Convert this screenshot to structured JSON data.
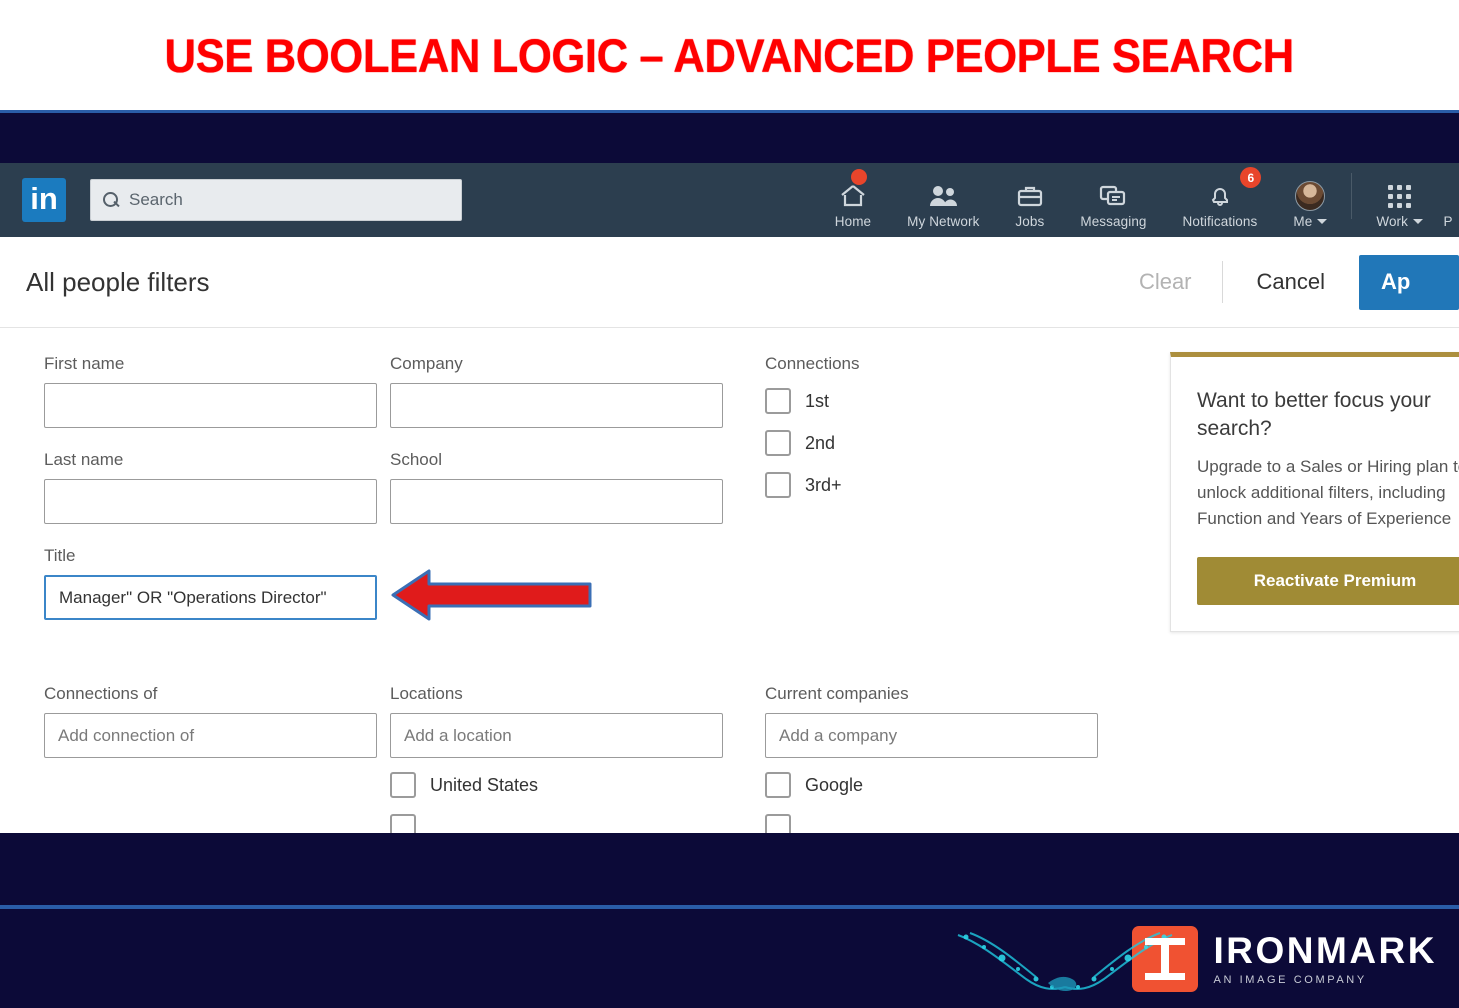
{
  "slide": {
    "title": "USE BOOLEAN LOGIC – ADVANCED PEOPLE SEARCH",
    "title_color": "#FF0000",
    "band_color": "#0C0A38",
    "accent_line_color": "#2A5DA8"
  },
  "nav": {
    "logo_text": "in",
    "logo_color": "#1B7BBF",
    "bar_color": "#2C3E4F",
    "search": {
      "placeholder": "Search",
      "icon": "search-icon",
      "value": ""
    },
    "items": [
      {
        "label": "Home",
        "icon": "home-icon",
        "badge": "",
        "badge_dot": true
      },
      {
        "label": "My Network",
        "icon": "people-icon",
        "badge": "",
        "badge_dot": false
      },
      {
        "label": "Jobs",
        "icon": "briefcase-icon",
        "badge": "",
        "badge_dot": false
      },
      {
        "label": "Messaging",
        "icon": "message-icon",
        "badge": "",
        "badge_dot": false
      },
      {
        "label": "Notifications",
        "icon": "bell-icon",
        "badge": "6",
        "badge_dot": false
      }
    ],
    "me": {
      "label": "Me",
      "icon": "avatar",
      "caret": "chevron-down-icon"
    },
    "work": {
      "label": "Work",
      "icon": "grid-icon",
      "caret": "chevron-down-icon"
    },
    "post": {
      "label": "P"
    }
  },
  "filters": {
    "title": "All people filters",
    "clear_label": "Clear",
    "cancel_label": "Cancel",
    "apply_label": "Ap",
    "apply_color": "#2177B8",
    "fields": {
      "first_name": {
        "label": "First name",
        "value": "",
        "placeholder": ""
      },
      "last_name": {
        "label": "Last name",
        "value": "",
        "placeholder": ""
      },
      "title": {
        "label": "Title",
        "value": "Manager\" OR \"Operations Director\"",
        "focused": true
      },
      "company": {
        "label": "Company",
        "value": "",
        "placeholder": ""
      },
      "school": {
        "label": "School",
        "value": "",
        "placeholder": ""
      },
      "connections_of": {
        "label": "Connections of",
        "value": "",
        "placeholder": "Add connection of"
      },
      "locations": {
        "label": "Locations",
        "value": "",
        "placeholder": "Add a location"
      },
      "current_companies": {
        "label": "Current companies",
        "value": "",
        "placeholder": "Add a company"
      }
    },
    "connections": {
      "label": "Connections",
      "options": [
        {
          "label": "1st",
          "checked": false
        },
        {
          "label": "2nd",
          "checked": false
        },
        {
          "label": "3rd+",
          "checked": false
        }
      ]
    },
    "location_options": [
      {
        "label": "United States",
        "checked": false
      }
    ],
    "company_options": [
      {
        "label": "Google",
        "checked": false
      }
    ]
  },
  "premium": {
    "heading": "Want to better focus your search?",
    "body": "Upgrade to a Sales or Hiring plan to unlock additional filters, including Function and Years of Experience",
    "button_label": "Reactivate Premium",
    "accent_color": "#AC8F3E",
    "button_color": "#A08B35"
  },
  "annotation": {
    "arrow": "left-arrow",
    "arrow_color": "#E01B1B",
    "arrow_outline_color": "#3B6FB5"
  },
  "footer": {
    "brand": "IRONMARK",
    "tagline": "AN IMAGE COMPANY",
    "brand_color": "#F05232",
    "background": "#0C0A38",
    "graphic": "digital-handshake-graphic"
  }
}
